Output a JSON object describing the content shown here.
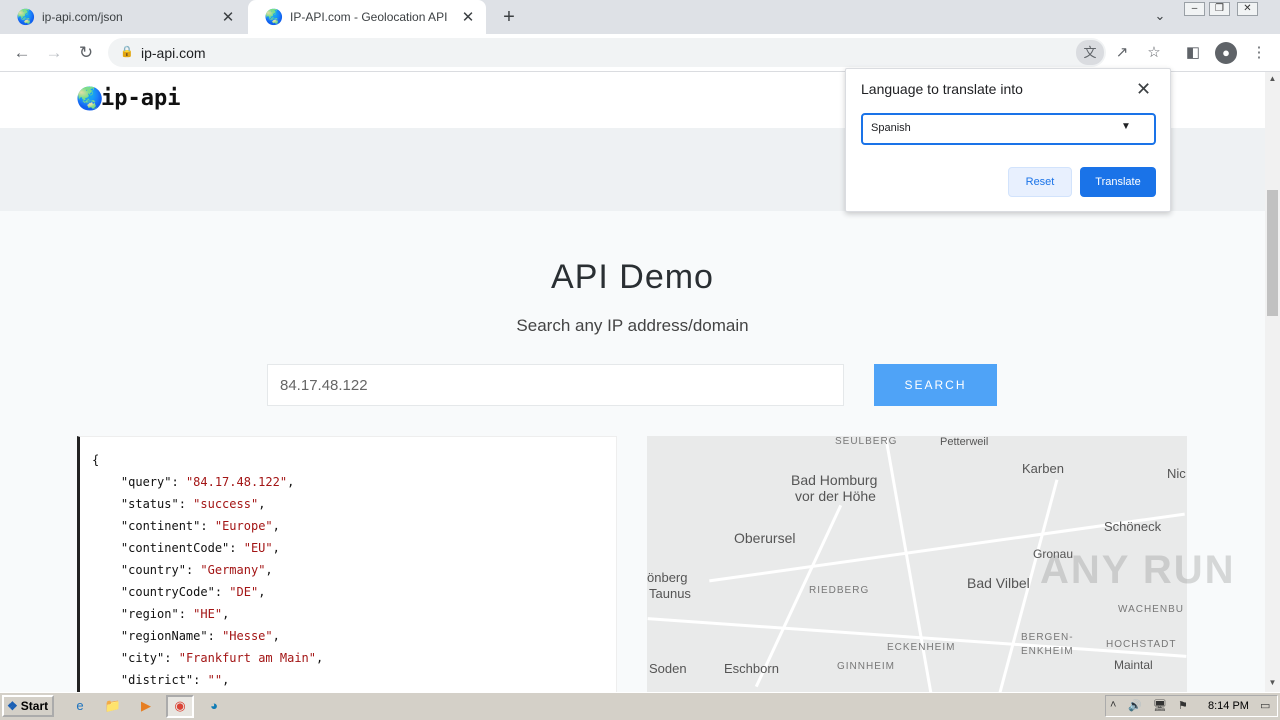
{
  "browser": {
    "tabs": [
      {
        "title": "ip-api.com/json",
        "active": false
      },
      {
        "title": "IP-API.com - Geolocation API",
        "active": true
      }
    ],
    "url": "ip-api.com"
  },
  "page": {
    "logo_text": "ip-api",
    "demo_title": "API Demo",
    "demo_subtitle": "Search any IP address/domain",
    "search_value": "84.17.48.122",
    "search_button": "SEARCH",
    "json_lines": {
      "open": "{",
      "l1": {
        "key": "\"query\"",
        "val": "\"84.17.48.122\""
      },
      "l2": {
        "key": "\"status\"",
        "val": "\"success\""
      },
      "l3": {
        "key": "\"continent\"",
        "val": "\"Europe\""
      },
      "l4": {
        "key": "\"continentCode\"",
        "val": "\"EU\""
      },
      "l5": {
        "key": "\"country\"",
        "val": "\"Germany\""
      },
      "l6": {
        "key": "\"countryCode\"",
        "val": "\"DE\""
      },
      "l7": {
        "key": "\"region\"",
        "val": "\"HE\""
      },
      "l8": {
        "key": "\"regionName\"",
        "val": "\"Hesse\""
      },
      "l9": {
        "key": "\"city\"",
        "val": "\"Frankfurt am Main\""
      },
      "l10": {
        "key": "\"district\"",
        "val": "\"\""
      }
    },
    "map_labels": {
      "seulberg": "SEULBERG",
      "petterweil": "Petterweil",
      "bad_homburg": "Bad Homburg",
      "vor_der_hohe": "vor der Höhe",
      "karben": "Karben",
      "nic": "Nic",
      "oberursel": "Oberursel",
      "schoneck": "Schöneck",
      "gronau": "Gronau",
      "konberg": "önberg",
      "taunus": "Taunus",
      "riedberg": "RIEDBERG",
      "bad_vilbel": "Bad Vilbel",
      "wachenbu": "WACHENBU",
      "bergen": "BERGEN-",
      "enkheim": "ENKHEIM",
      "hochstadt": "HOCHSTADT",
      "eckenheim": "ECKENHEIM",
      "soden": "Soden",
      "eschborn": "Eschborn",
      "ginnheim": "GINNHEIM",
      "maintal": "Maintal"
    },
    "watermark": "ANY RUN"
  },
  "translate_popup": {
    "title": "Language to translate into",
    "language": "Spanish",
    "reset": "Reset",
    "translate": "Translate"
  },
  "taskbar": {
    "start": "Start",
    "clock": "8:14 PM"
  }
}
